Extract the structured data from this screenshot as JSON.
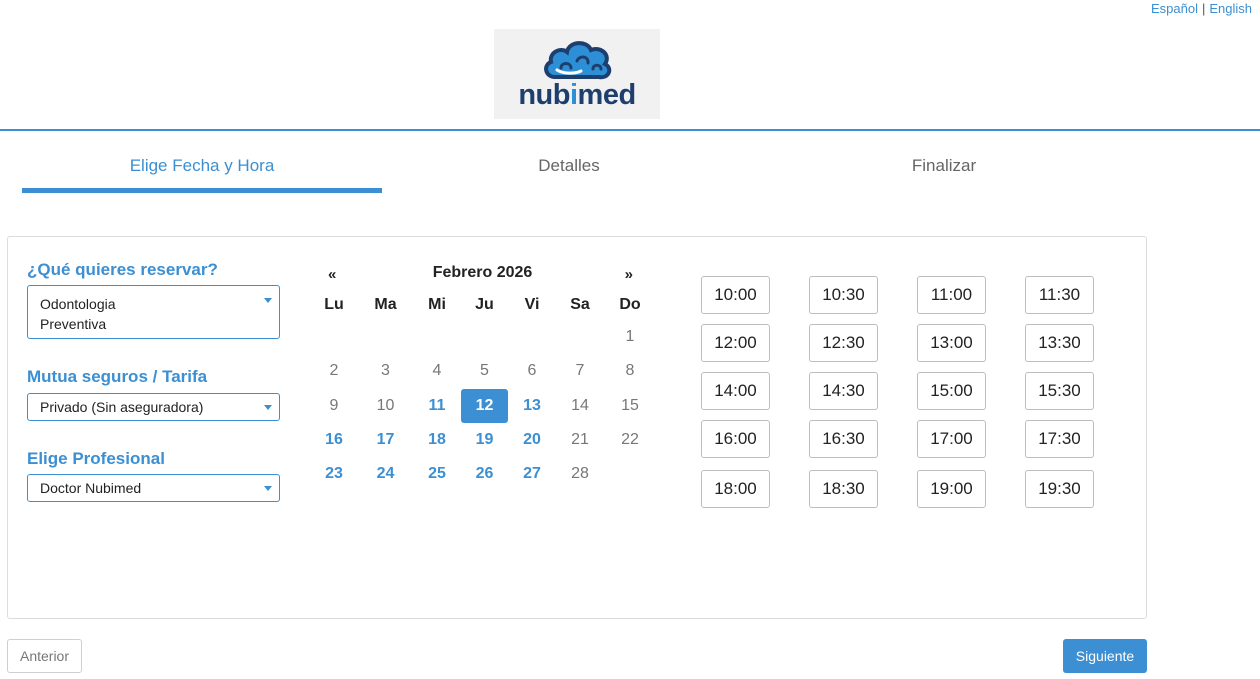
{
  "lang": {
    "es": "Español",
    "sep": "|",
    "en": "English"
  },
  "logo": {
    "text_a": "nub",
    "text_b": "i",
    "text_c": "med"
  },
  "steps": [
    {
      "label": "Elige Fecha y Hora",
      "active": true
    },
    {
      "label": "Detalles",
      "active": false
    },
    {
      "label": "Finalizar",
      "active": false
    }
  ],
  "form": {
    "service_label": "¿Qué quieres reservar?",
    "service_value_1": "Odontologia",
    "service_value_2": "Preventiva",
    "insurance_label": "Mutua seguros / Tarifa",
    "insurance_value": "Privado (Sin aseguradora)",
    "professional_label": "Elige Profesional",
    "professional_value": "Doctor Nubimed"
  },
  "calendar": {
    "prev": "«",
    "next": "»",
    "month": "Febrero 2026",
    "weekdays": [
      "Lu",
      "Ma",
      "Mi",
      "Ju",
      "Vi",
      "Sa",
      "Do"
    ],
    "lead_blanks": 6,
    "days": [
      {
        "n": "1",
        "state": "off"
      },
      {
        "n": "2",
        "state": "off"
      },
      {
        "n": "3",
        "state": "off"
      },
      {
        "n": "4",
        "state": "off"
      },
      {
        "n": "5",
        "state": "off"
      },
      {
        "n": "6",
        "state": "off"
      },
      {
        "n": "7",
        "state": "off"
      },
      {
        "n": "8",
        "state": "off"
      },
      {
        "n": "9",
        "state": "off"
      },
      {
        "n": "10",
        "state": "off"
      },
      {
        "n": "11",
        "state": "avail"
      },
      {
        "n": "12",
        "state": "selected"
      },
      {
        "n": "13",
        "state": "avail"
      },
      {
        "n": "14",
        "state": "off"
      },
      {
        "n": "15",
        "state": "off"
      },
      {
        "n": "16",
        "state": "avail"
      },
      {
        "n": "17",
        "state": "avail"
      },
      {
        "n": "18",
        "state": "avail"
      },
      {
        "n": "19",
        "state": "avail"
      },
      {
        "n": "20",
        "state": "avail"
      },
      {
        "n": "21",
        "state": "off"
      },
      {
        "n": "22",
        "state": "off"
      },
      {
        "n": "23",
        "state": "avail"
      },
      {
        "n": "24",
        "state": "avail"
      },
      {
        "n": "25",
        "state": "avail"
      },
      {
        "n": "26",
        "state": "avail"
      },
      {
        "n": "27",
        "state": "avail"
      },
      {
        "n": "28",
        "state": "off"
      }
    ]
  },
  "slots": [
    "10:00",
    "10:30",
    "11:00",
    "11:30",
    "12:00",
    "12:30",
    "13:00",
    "13:30",
    "14:00",
    "14:30",
    "15:00",
    "15:30",
    "16:00",
    "16:30",
    "17:00",
    "17:30",
    "18:00",
    "18:30",
    "19:00",
    "19:30"
  ],
  "buttons": {
    "prev": "Anterior",
    "next": "Siguiente"
  },
  "colors": {
    "accent": "#3b8fd2",
    "logo_dark": "#1e3f6e"
  }
}
